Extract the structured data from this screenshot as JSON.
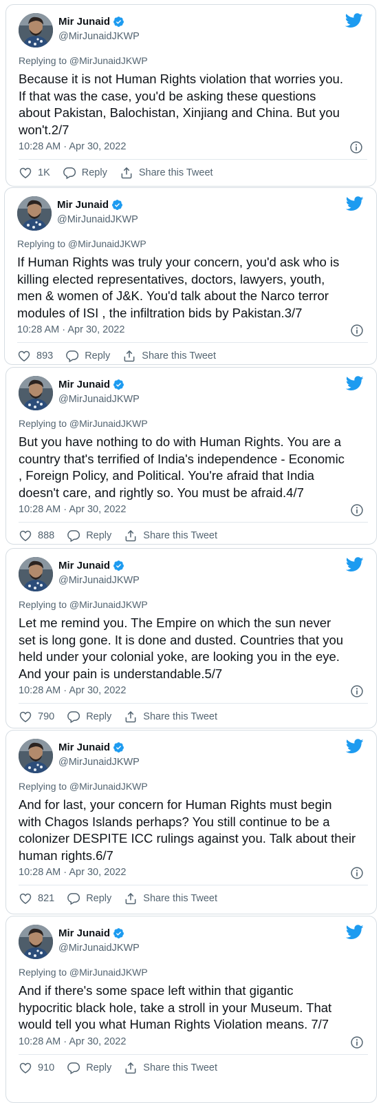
{
  "colors": {
    "twitter_blue": "#1d9bf0",
    "text_primary": "#0f1419",
    "text_secondary": "#536471",
    "border": "#d6dde3"
  },
  "icons": [
    "twitter-bird-icon",
    "verified-badge-icon",
    "heart-icon",
    "reply-bubble-icon",
    "share-icon",
    "info-icon"
  ],
  "tweets": [
    {
      "author_name": "Mir Junaid",
      "author_handle": "@MirJunaidJKWP",
      "replying_to": "Replying to @MirJunaidJKWP",
      "text": "Because it is not Human Rights violation that worries you.\nIf that was the case, you'd be asking these questions\nabout Pakistan, Balochistan, Xinjiang and China. But you\nwon't.2/7",
      "timestamp": "10:28 AM · Apr 30, 2022",
      "likes": "1K",
      "reply_label": "Reply",
      "share_label": "Share this Tweet"
    },
    {
      "author_name": "Mir Junaid",
      "author_handle": "@MirJunaidJKWP",
      "replying_to": "Replying to @MirJunaidJKWP",
      "text": "If Human Rights was truly your concern, you'd ask who is\nkilling elected representatives, doctors, lawyers, youth,\nmen & women of J&K. You'd talk about the Narco terror\nmodules of ISI , the infiltration bids by Pakistan.3/7",
      "timestamp": "10:28 AM · Apr 30, 2022",
      "likes": "893",
      "reply_label": "Reply",
      "share_label": "Share this Tweet"
    },
    {
      "author_name": "Mir Junaid",
      "author_handle": "@MirJunaidJKWP",
      "replying_to": "Replying to @MirJunaidJKWP",
      "text": "But you have nothing to do with Human Rights. You are a\ncountry that's terrified of India's independence - Economic\n, Foreign Policy, and Political. You're afraid that India\ndoesn't care, and rightly so. You must be afraid.4/7",
      "timestamp": "10:28 AM · Apr 30, 2022",
      "likes": "888",
      "reply_label": "Reply",
      "share_label": "Share this Tweet"
    },
    {
      "author_name": "Mir Junaid",
      "author_handle": "@MirJunaidJKWP",
      "replying_to": "Replying to @MirJunaidJKWP",
      "text": "Let me remind you. The Empire on which the sun never\nset is long gone. It is done and dusted. Countries that you\nheld under your colonial yoke, are looking you in the eye.\nAnd your pain is understandable.5/7",
      "timestamp": "10:28 AM · Apr 30, 2022",
      "likes": "790",
      "reply_label": "Reply",
      "share_label": "Share this Tweet"
    },
    {
      "author_name": "Mir Junaid",
      "author_handle": "@MirJunaidJKWP",
      "replying_to": "Replying to @MirJunaidJKWP",
      "text": "And for last, your concern for Human Rights must begin\nwith Chagos Islands perhaps? You still continue to be a\ncolonizer DESPITE ICC rulings against you. Talk about their\nhuman rights.6/7",
      "timestamp": "10:28 AM · Apr 30, 2022",
      "likes": "821",
      "reply_label": "Reply",
      "share_label": "Share this Tweet"
    },
    {
      "author_name": "Mir Junaid",
      "author_handle": "@MirJunaidJKWP",
      "replying_to": "Replying to @MirJunaidJKWP",
      "text": "And if there's some space left within that gigantic\nhypocritic black hole, take a stroll in your Museum. That\nwould tell you what Human Rights Violation means. 7/7",
      "timestamp": "10:28 AM · Apr 30, 2022",
      "likes": "910",
      "reply_label": "Reply",
      "share_label": "Share this Tweet"
    }
  ]
}
